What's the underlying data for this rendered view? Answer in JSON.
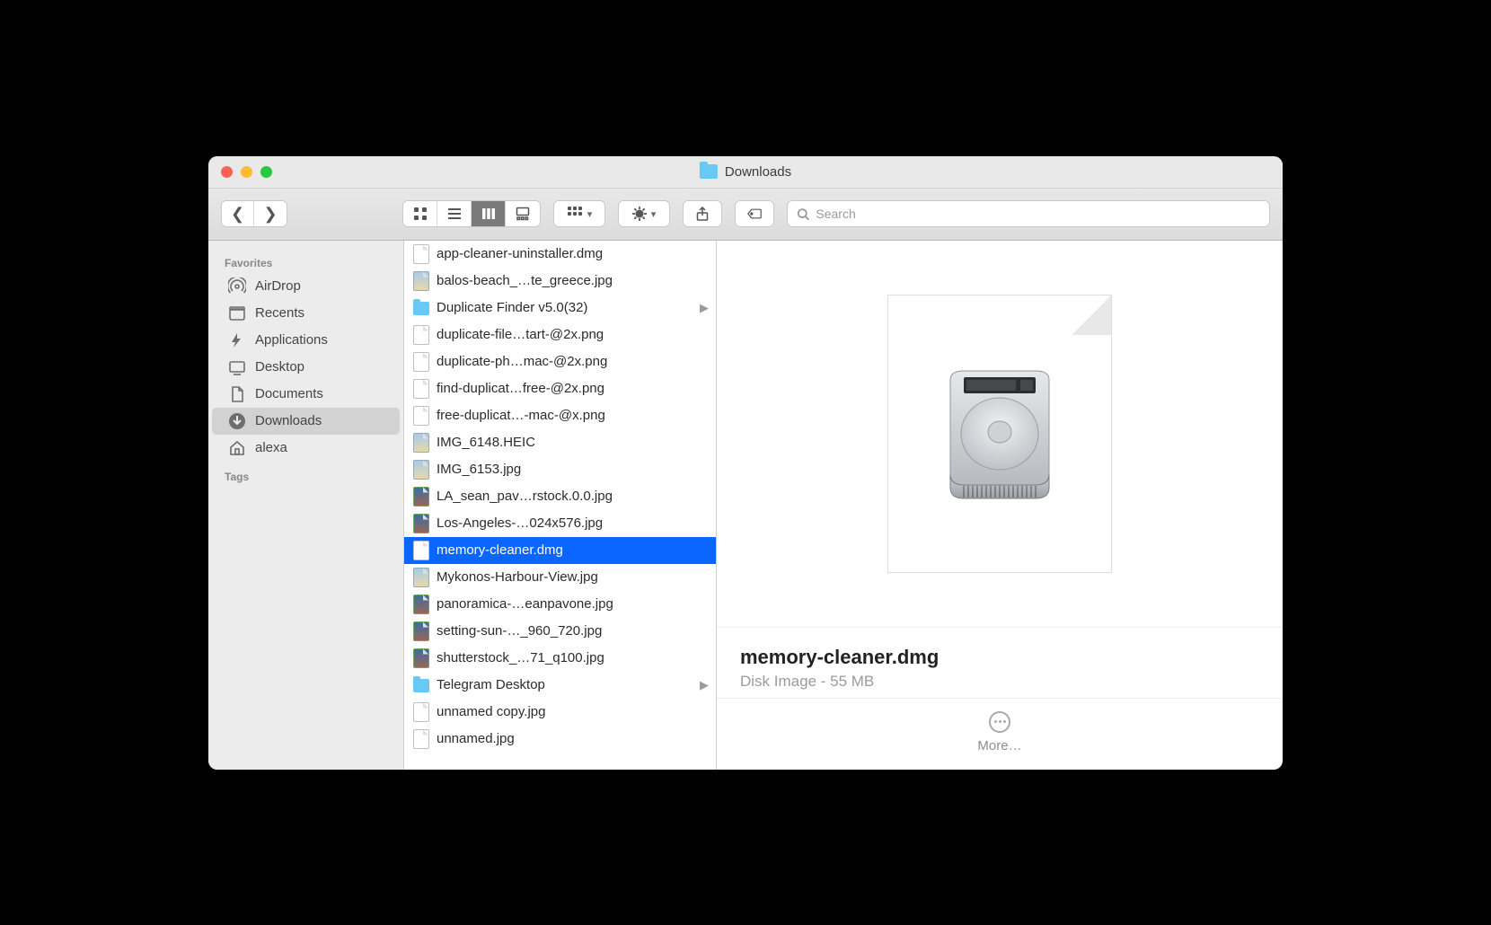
{
  "window": {
    "title": "Downloads"
  },
  "toolbar": {
    "search_placeholder": "Search"
  },
  "sidebar": {
    "section_favorites": "Favorites",
    "section_tags": "Tags",
    "items": [
      {
        "label": "AirDrop"
      },
      {
        "label": "Recents"
      },
      {
        "label": "Applications"
      },
      {
        "label": "Desktop"
      },
      {
        "label": "Documents"
      },
      {
        "label": "Downloads"
      },
      {
        "label": "alexa"
      }
    ]
  },
  "files": [
    {
      "name": "app-cleaner-uninstaller.dmg",
      "kind": "doc"
    },
    {
      "name": "balos-beach_…te_greece.jpg",
      "kind": "img"
    },
    {
      "name": "Duplicate Finder v5.0(32)",
      "kind": "folder"
    },
    {
      "name": "duplicate-file…tart-@2x.png",
      "kind": "doc"
    },
    {
      "name": "duplicate-ph…mac-@2x.png",
      "kind": "doc"
    },
    {
      "name": "find-duplicat…free-@2x.png",
      "kind": "doc"
    },
    {
      "name": "free-duplicat…-mac-@x.png",
      "kind": "doc"
    },
    {
      "name": "IMG_6148.HEIC",
      "kind": "img"
    },
    {
      "name": "IMG_6153.jpg",
      "kind": "img"
    },
    {
      "name": "LA_sean_pav…rstock.0.0.jpg",
      "kind": "img2"
    },
    {
      "name": "Los-Angeles-…024x576.jpg",
      "kind": "img2"
    },
    {
      "name": "memory-cleaner.dmg",
      "kind": "doc",
      "selected": true
    },
    {
      "name": "Mykonos-Harbour-View.jpg",
      "kind": "img"
    },
    {
      "name": "panoramica-…eanpavone.jpg",
      "kind": "img2"
    },
    {
      "name": "setting-sun-…_960_720.jpg",
      "kind": "img2"
    },
    {
      "name": "shutterstock_…71_q100.jpg",
      "kind": "img2"
    },
    {
      "name": "Telegram Desktop",
      "kind": "folder"
    },
    {
      "name": "unnamed copy.jpg",
      "kind": "doc"
    },
    {
      "name": "unnamed.jpg",
      "kind": "doc"
    }
  ],
  "preview": {
    "name": "memory-cleaner.dmg",
    "kind": "Disk Image - 55 MB",
    "more_label": "More…"
  },
  "colors": {
    "selection": "#0a66ff",
    "close": "#ff5f57",
    "minimize": "#febc2e",
    "zoom": "#28c840"
  }
}
